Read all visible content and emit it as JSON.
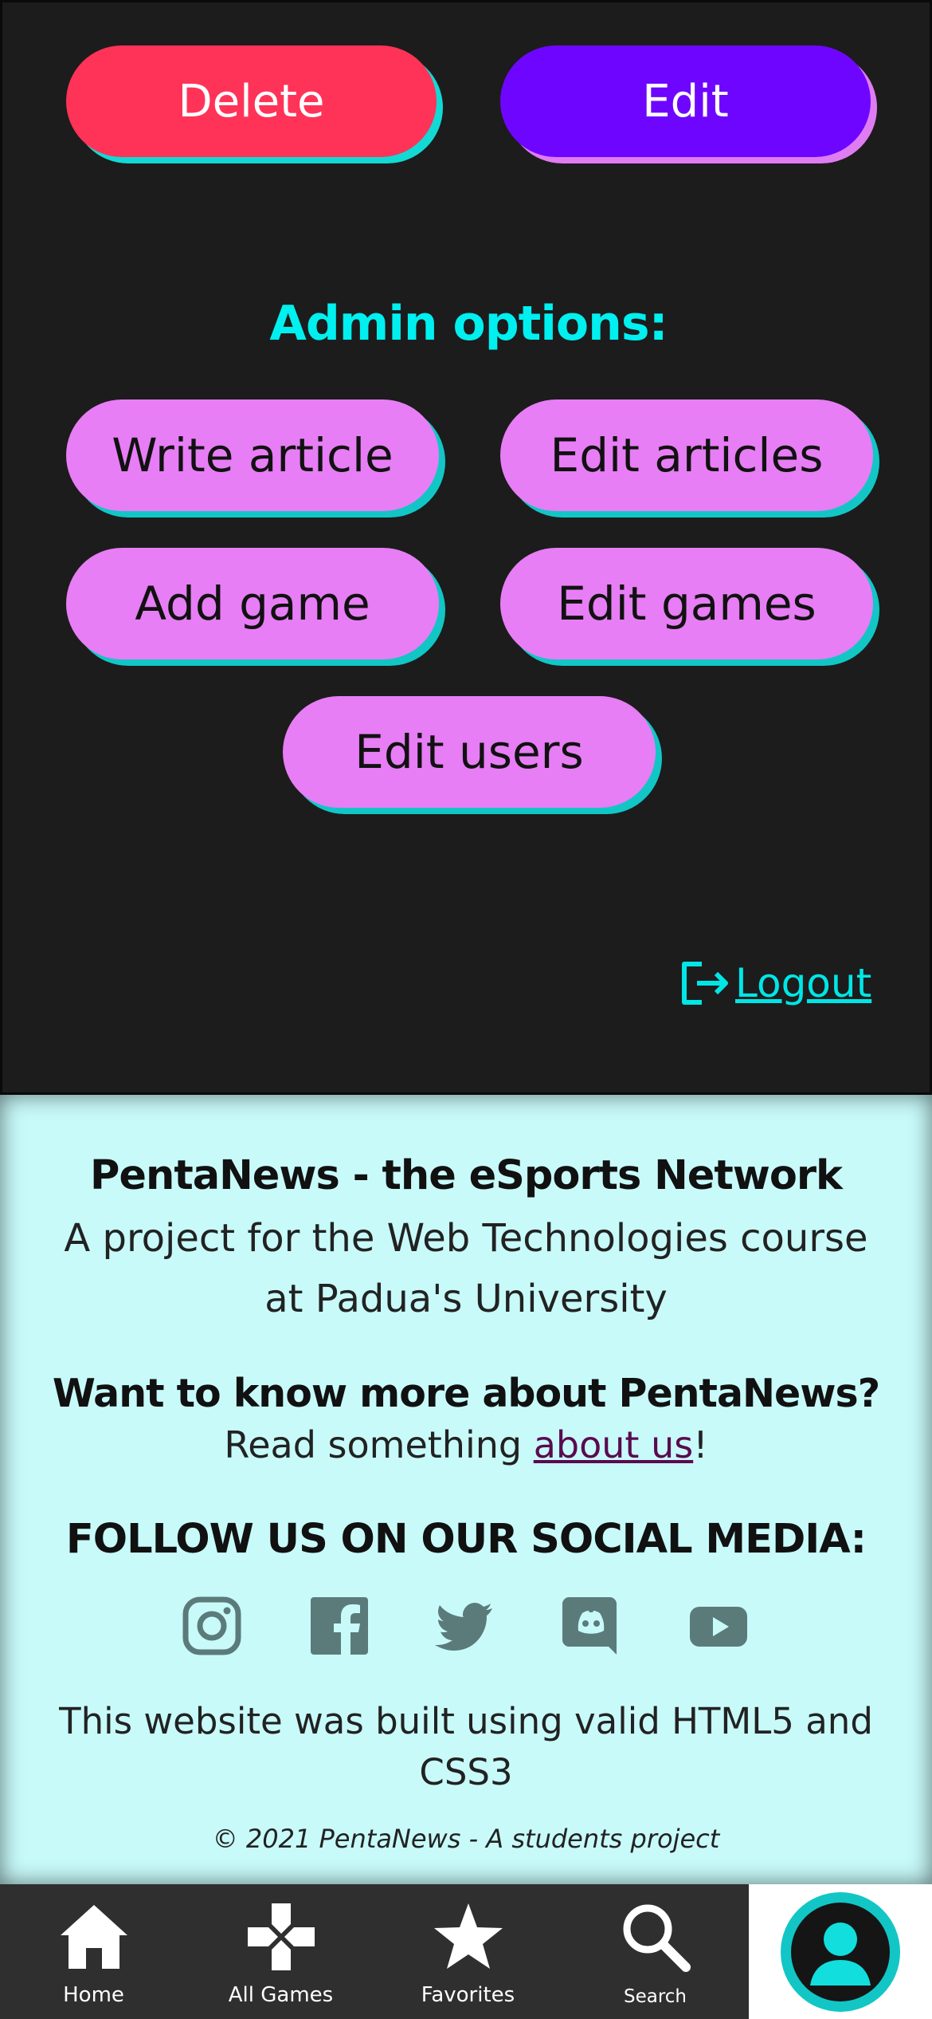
{
  "actions": {
    "delete_label": "Delete",
    "edit_label": "Edit"
  },
  "admin": {
    "title": "Admin options:",
    "write_article": "Write article",
    "edit_articles": "Edit articles",
    "add_game": "Add game",
    "edit_games": "Edit games",
    "edit_users": "Edit users"
  },
  "logout_label": "Logout",
  "footer": {
    "title": "PentaNews - the eSports Network",
    "subtitle": "A project for the Web Technologies course at Padua's University",
    "question": "Want to know more about PentaNews?",
    "read_prefix": "Read something ",
    "about_link": "about us",
    "read_suffix": "!",
    "follow": "FOLLOW US ON OUR SOCIAL MEDIA:",
    "built_with": "This website was built using valid HTML5 and CSS3",
    "copyright": "© 2021 PentaNews - A students project",
    "socials": [
      "instagram-icon",
      "facebook-icon",
      "twitter-icon",
      "discord-icon",
      "youtube-icon"
    ]
  },
  "nav": {
    "home": "Home",
    "all_games": "All Games",
    "favorites": "Favorites",
    "search": "Search"
  },
  "colors": {
    "delete": "#ff3358",
    "edit": "#6e06ff",
    "admin_button": "#e77ef5",
    "accent": "#00f0f0",
    "footer_bg": "#c8fafa"
  }
}
